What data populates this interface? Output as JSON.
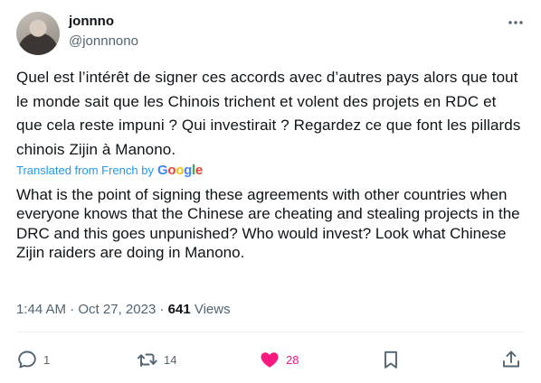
{
  "user": {
    "display_name": "jonnno",
    "handle": "@jonnnono"
  },
  "tweet": {
    "original_text": "Quel est l’intérêt de signer ces accords avec d’autres pays alors que tout le monde sait que les Chinois trichent et volent des projets en RDC et que cela reste impuni ? Qui investirait ? Regardez ce que font les pillards chinois Zijin à Manono.",
    "translated_label": "Translated from French by",
    "translator": "Google",
    "translated_text": "What is the point of signing these agreements with other countries when everyone knows that the Chinese are cheating and stealing projects in the DRC and this goes unpunished? Who would invest? Look what Chinese Zijin raiders are doing in Manono.",
    "time": "1:44 AM",
    "separator": "·",
    "date": "Oct 27, 2023",
    "views_count": "641",
    "views_label": "Views"
  },
  "actions": {
    "replies": "1",
    "reposts": "14",
    "likes": "28"
  },
  "icons": {
    "more": "more-dots-icon",
    "reply": "reply-icon",
    "repost": "repost-icon",
    "like": "heart-filled-icon",
    "bookmark": "bookmark-icon",
    "share": "share-icon"
  },
  "colors": {
    "text": "#0f1419",
    "secondary": "#536471",
    "link": "#1d9bf0",
    "like": "#f91880",
    "google_blue": "#4285f4",
    "google_red": "#ea4335",
    "google_yellow": "#fbbc05",
    "google_green": "#34a853"
  }
}
